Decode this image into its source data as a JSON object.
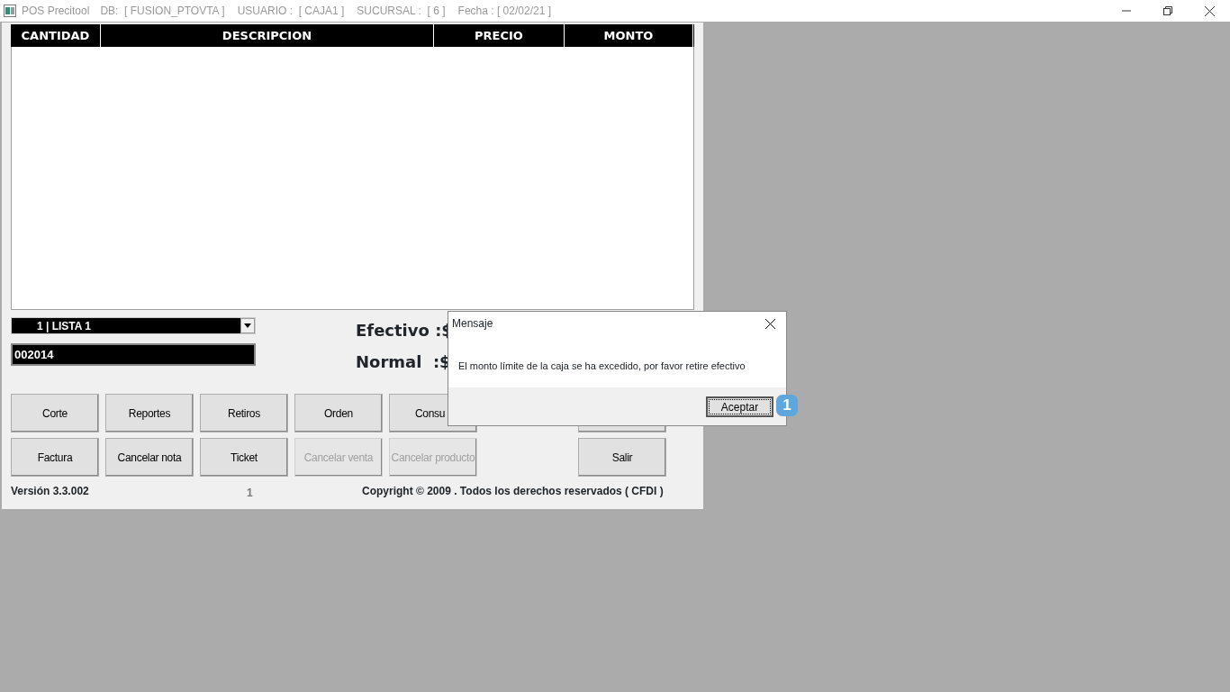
{
  "window": {
    "title": "POS Precitool",
    "info": [
      "DB:  [ FUSION_PTOVTA ]",
      "USUARIO :  [ CAJA1 ]",
      "SUCURSAL :  [ 6 ]",
      "Fecha : [ 02/02/21 ]"
    ]
  },
  "table": {
    "columns": [
      "CANTIDAD",
      "DESCRIPCION",
      "PRECIO",
      "MONTO"
    ]
  },
  "price_list": {
    "value": "1  | LISTA 1"
  },
  "code_field": {
    "value": "002014"
  },
  "totals": [
    "Efectivo :$",
    "Normal  :$"
  ],
  "buttons": [
    {
      "label": "Corte",
      "disabled": false
    },
    {
      "label": "Reportes",
      "disabled": false
    },
    {
      "label": "Retiros",
      "disabled": false
    },
    {
      "label": "Orden",
      "disabled": false
    },
    {
      "label": "Consu",
      "disabled": false
    },
    {
      "disabled": false
    },
    {
      "label": "Factura",
      "disabled": false
    },
    {
      "label": "Cancelar nota",
      "disabled": false
    },
    {
      "label": "Ticket",
      "disabled": false
    },
    {
      "label": "Cancelar venta",
      "disabled": true
    },
    {
      "label": "Cancelar producto",
      "disabled": true
    },
    {
      "label": "Salir",
      "disabled": false
    }
  ],
  "footer": {
    "version": "Versión 3.3.002",
    "page": "1",
    "copyright": "Copyright © 2009 . Todos los derechos reservados ( CFDI )"
  },
  "dialog": {
    "title": "Mensaje",
    "message": "El monto límite de la caja se ha excedido, por favor retire efectivo",
    "button": "Aceptar",
    "callout": "1"
  }
}
